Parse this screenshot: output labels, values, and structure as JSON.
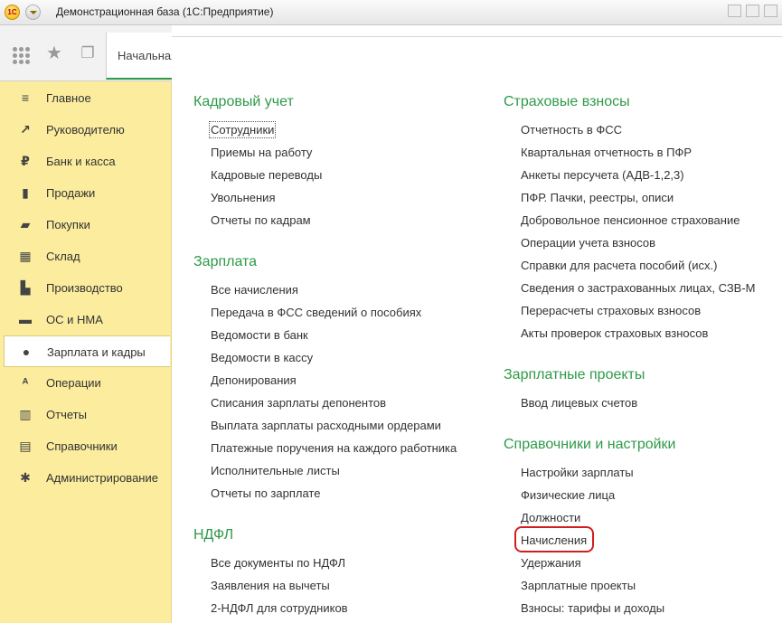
{
  "window": {
    "title": "Демонстрационная база  (1С:Предприятие)",
    "logo_text": "1С"
  },
  "tabs": [
    {
      "label": "Начальная"
    }
  ],
  "sidebar": {
    "items": [
      {
        "label": "Главное",
        "icon": "menu-icon",
        "glyph": "≡"
      },
      {
        "label": "Руководителю",
        "icon": "trend-icon",
        "glyph": "↗"
      },
      {
        "label": "Банк и касса",
        "icon": "ruble-icon",
        "glyph": "₽"
      },
      {
        "label": "Продажи",
        "icon": "bag-icon",
        "glyph": "▮"
      },
      {
        "label": "Покупки",
        "icon": "cart-icon",
        "glyph": "▰"
      },
      {
        "label": "Склад",
        "icon": "warehouse-icon",
        "glyph": "▦"
      },
      {
        "label": "Производство",
        "icon": "factory-icon",
        "glyph": "▙"
      },
      {
        "label": "ОС и НМА",
        "icon": "truck-icon",
        "glyph": "▬"
      },
      {
        "label": "Зарплата и кадры",
        "icon": "person-icon",
        "glyph": "●",
        "active": true
      },
      {
        "label": "Операции",
        "icon": "operations-icon",
        "glyph": "ᴬ"
      },
      {
        "label": "Отчеты",
        "icon": "bar-chart-icon",
        "glyph": "▥"
      },
      {
        "label": "Справочники",
        "icon": "book-icon",
        "glyph": "▤"
      },
      {
        "label": "Администрирование",
        "icon": "gear-icon",
        "glyph": "✱"
      }
    ]
  },
  "left_column": [
    {
      "title": "Кадровый учет",
      "links": [
        "Сотрудники",
        "Приемы на работу",
        "Кадровые переводы",
        "Увольнения",
        "Отчеты по кадрам"
      ]
    },
    {
      "title": "Зарплата",
      "links": [
        "Все начисления",
        "Передача в ФСС сведений о пособиях",
        "Ведомости в банк",
        "Ведомости в кассу",
        "Депонирования",
        "Списания зарплаты депонентов",
        "Выплата зарплаты расходными ордерами",
        "Платежные поручения на каждого работника",
        "Исполнительные листы",
        "Отчеты по зарплате"
      ]
    },
    {
      "title": "НДФЛ",
      "links": [
        "Все документы по НДФЛ",
        "Заявления на вычеты",
        "2-НДФЛ для сотрудников"
      ]
    }
  ],
  "right_column": [
    {
      "title": "Страховые взносы",
      "links": [
        "Отчетность в ФСС",
        "Квартальная отчетность в ПФР",
        "Анкеты персучета (АДВ-1,2,3)",
        "ПФР. Пачки, реестры, описи",
        "Добровольное пенсионное страхование",
        "Операции учета взносов",
        "Справки для расчета пособий (исх.)",
        "Сведения о застрахованных лицах, СЗВ-М",
        "Перерасчеты страховых взносов",
        "Акты проверок страховых взносов"
      ]
    },
    {
      "title": "Зарплатные проекты",
      "links": [
        "Ввод лицевых счетов"
      ]
    },
    {
      "title": "Справочники и настройки",
      "links": [
        "Настройки зарплаты",
        "Физические лица",
        "Должности",
        "Начисления",
        "Удержания",
        "Зарплатные проекты",
        "Взносы: тарифы и доходы"
      ]
    }
  ],
  "colors": {
    "accent": "#2f9a48",
    "sidebar_bg": "#fbec9e",
    "highlight": "#d11f1f"
  }
}
